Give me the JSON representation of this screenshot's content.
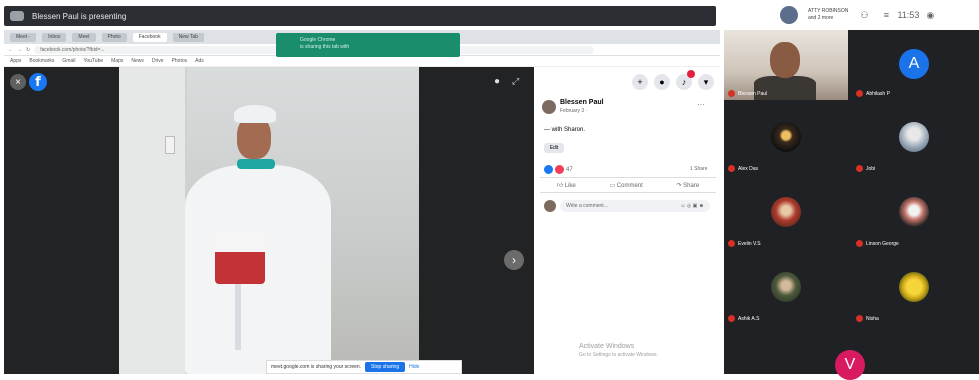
{
  "meet": {
    "presenting_text": "Blessen Paul is presenting",
    "top_right": {
      "speaker_line1": "ATTY ROBINSON",
      "speaker_line2": "and 2 more",
      "time": "11:53"
    }
  },
  "browser": {
    "tabs": [
      "Meet - ",
      "Inbox",
      "Meet",
      "Photo",
      "Facebook",
      "New Tab"
    ],
    "toast_line1": "Google Chrome",
    "toast_line2": "is sharing this tab with",
    "url": "facebook.com/photo/?fbid=...",
    "bookmarks": [
      "Apps",
      "Bookmarks",
      "Gmail",
      "YouTube",
      "Maps",
      "News",
      "Drive",
      "Photos",
      "Ads"
    ]
  },
  "photo": {
    "close_symbol": "×",
    "fb_logo": "f",
    "next_symbol": "›",
    "tag_symbol": "●",
    "expand_symbol": "⤢"
  },
  "post": {
    "author": "Blessen Paul",
    "date": "February 3 · ",
    "with_text": "— with Sharon.",
    "edit_label": "Edit",
    "reaction_count": "47",
    "shares": "1 Share",
    "actions": [
      "Like",
      "Comment",
      "Share"
    ],
    "comment_placeholder": "Write a comment..."
  },
  "windows": {
    "activate_title": "Activate Windows",
    "activate_sub": "Go to Settings to activate Windows."
  },
  "sharing_bar": {
    "text": "meet.google.com is sharing your screen.",
    "stop_label": "Stop sharing",
    "hide_label": "Hide"
  },
  "participants": [
    {
      "name": "Blessen Paul",
      "type": "camera"
    },
    {
      "name": "Abhilash P",
      "letter": "A",
      "color": "#1a73e8"
    },
    {
      "name": "Alex Das",
      "type": "photo"
    },
    {
      "name": "Jobi",
      "type": "photo"
    },
    {
      "name": "Evelin V.S",
      "type": "photo"
    },
    {
      "name": "Linson George",
      "type": "photo"
    },
    {
      "name": "Ashik A.S",
      "type": "photo"
    },
    {
      "name": "Nisha",
      "type": "photo"
    },
    {
      "name": "",
      "letter": "V",
      "color": "#d81b60"
    }
  ],
  "colors": {
    "meet_dark": "#202124",
    "tile": "#3c4043",
    "fb_blue": "#1877f2",
    "meet_green_toast": "#1a8d6d",
    "mic_off_red": "#d93025"
  }
}
